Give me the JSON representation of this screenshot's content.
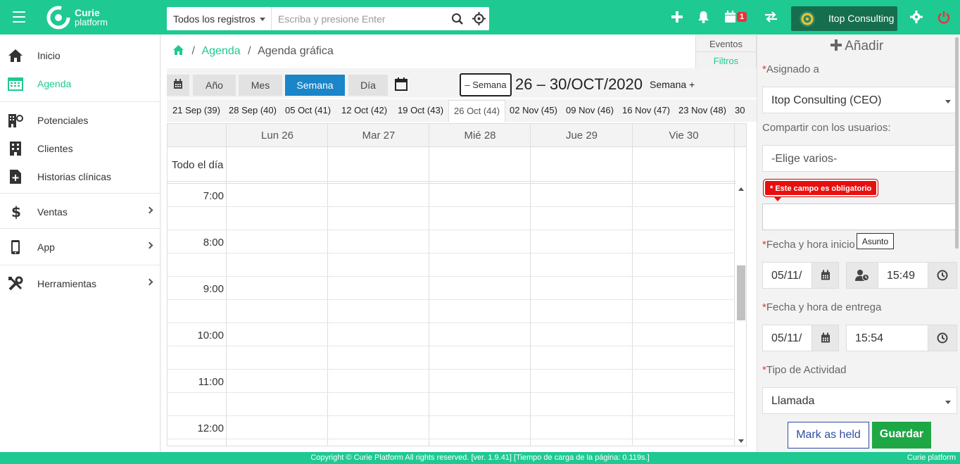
{
  "app": {
    "logo_line1": "Curie",
    "logo_line2": "platform",
    "brand_color": "#1fc992"
  },
  "search": {
    "scope": "Todos los registros",
    "placeholder": "Escriba y presione Enter"
  },
  "header": {
    "notification_badge": "1",
    "company_name": "Itop Consulting"
  },
  "sidebar": {
    "items": [
      {
        "label": "Inicio",
        "icon": "home-icon"
      },
      {
        "label": "Agenda",
        "icon": "calendar-icon"
      },
      {
        "label": "Potenciales",
        "icon": "building-user-icon"
      },
      {
        "label": "Clientes",
        "icon": "building-icon"
      },
      {
        "label": "Historias clínicas",
        "icon": "medical-file-icon"
      },
      {
        "label": "Ventas",
        "icon": "dollar-icon"
      },
      {
        "label": "App",
        "icon": "mobile-icon"
      },
      {
        "label": "Herramientas",
        "icon": "tools-icon"
      }
    ]
  },
  "breadcrumb": {
    "link": "Agenda",
    "current": "Agenda gráfica"
  },
  "panel_tabs": {
    "events": "Eventos",
    "filters": "Filtros"
  },
  "views": {
    "year": "Año",
    "month": "Mes",
    "week": "Semana",
    "day": "Día"
  },
  "nav": {
    "prev_label": "– Semana",
    "range": "26 – 30/OCT/2020",
    "next_label": "Semana +"
  },
  "weeks": [
    "21 Sep (39)",
    "28 Sep (40)",
    "05 Oct (41)",
    "12 Oct (42)",
    "19 Oct (43)",
    "26 Oct (44)",
    "02 Nov (45)",
    "09 Nov (46)",
    "16 Nov (47)",
    "23 Nov (48)",
    "30"
  ],
  "calendar": {
    "days": [
      "Lun 26",
      "Mar 27",
      "Mié 28",
      "Jue 29",
      "Vie 30"
    ],
    "all_day": "Todo el día",
    "times": [
      "7:00",
      "8:00",
      "9:00",
      "10:00",
      "11:00",
      "12:00"
    ]
  },
  "form": {
    "title": "Añadir",
    "assigned_label": "Asignado a",
    "assigned_value": "Itop Consulting (CEO)",
    "share_label": "Compartir con los usuarios:",
    "share_placeholder": "-Elige varios-",
    "error_text": "* Este campo es obligatorio",
    "subject_tooltip": "Asunto",
    "start_label": "Fecha y hora inicio",
    "start_date": "05/11/",
    "start_time": "15:49",
    "end_label": "Fecha y hora de entrega",
    "end_date": "05/11/",
    "end_time": "15:54",
    "activity_label": "Tipo de Actividad",
    "activity_value": "Llamada",
    "mark_held": "Mark as held",
    "save": "Guardar"
  },
  "footer": {
    "copyright": "Copyright © Curie Platform All rights reserved. [ver. 1.9.41] [Tiempo de carga de la página: 0.119s.]",
    "logo": "Curie platform"
  }
}
